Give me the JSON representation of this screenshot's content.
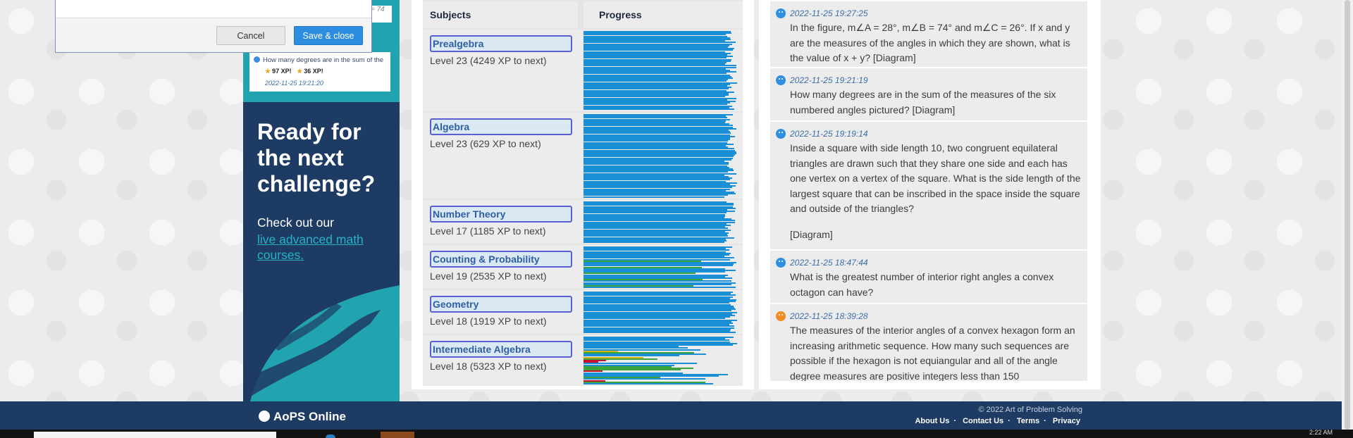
{
  "dialog": {
    "cancel_label": "Cancel",
    "save_label": "Save & close",
    "snippet_behind": "= 74"
  },
  "mini_activity": {
    "question": "How many degrees are in the sum of the",
    "xp_1": "97 XP!",
    "xp_2": "36 XP!",
    "date": "2022-11-25 19:21:20"
  },
  "promo": {
    "title": "Ready for the next challenge?",
    "text": "Check out our",
    "link": "live advanced math courses."
  },
  "table": {
    "header_subjects": "Subjects",
    "header_progress": "Progress",
    "rows": [
      {
        "name": "Prealgebra",
        "level": "Level 23 (4249 XP to next)"
      },
      {
        "name": "Algebra",
        "level": "Level 23 (629 XP to next)"
      },
      {
        "name": "Number Theory",
        "level": "Level 17 (1185 XP to next)"
      },
      {
        "name": "Counting & Probability",
        "level": "Level 19 (2535 XP to next)"
      },
      {
        "name": "Geometry",
        "level": "Level 18 (1919 XP to next)"
      },
      {
        "name": "Intermediate Algebra",
        "level": "Level 18 (5323 XP to next)"
      }
    ]
  },
  "activity": {
    "items": [
      {
        "date": "2022-11-25 19:27:25",
        "mood": "happy",
        "text": "In the figure, m∠A = 28°, m∠B = 74° and m∠C = 26°. If x and y are the measures of the angles in which they are shown, what is the value of x + y? [Diagram]"
      },
      {
        "date": "2022-11-25 19:21:19",
        "mood": "happy",
        "text": "How many degrees are in the sum of the measures of the six numbered angles pictured? [Diagram]"
      },
      {
        "date": "2022-11-25 19:19:14",
        "mood": "happy",
        "text": "Inside a square with side length 10, two congruent equilateral triangles are drawn such that they share one side and each has one vertex on a vertex of the square. What is the side length of the largest square that can be inscribed in the space inside the square and outside of the triangles?"
      },
      {
        "date": "2022-11-25 18:47:44",
        "mood": "happy",
        "text": "What is the greatest number of interior right angles a convex octagon can have?"
      },
      {
        "date": "2022-11-25 18:39:28",
        "mood": "sad",
        "text": "The measures of the interior angles of a convex hexagon form an increasing arithmetic sequence. How many such sequences are possible if the hexagon is not equiangular and all of the angle degree measures are positive integers less than 150"
      }
    ],
    "diagram_note": "[Diagram]"
  },
  "footer": {
    "logo": "AoPS Online",
    "copyright": "© 2022 Art of Problem Solving",
    "links": [
      "About Us",
      "Contact Us",
      "Terms",
      "Privacy"
    ],
    "separator": "·"
  },
  "taskbar": {
    "time": "2:22 AM"
  },
  "colors": {
    "navy": "#1e3b63",
    "teal": "#22a3b0",
    "progress_blue": "#1a8fd6",
    "progress_green": "#3aa33a",
    "progress_red": "#c8102e",
    "progress_yellow": "#d6b21a"
  }
}
